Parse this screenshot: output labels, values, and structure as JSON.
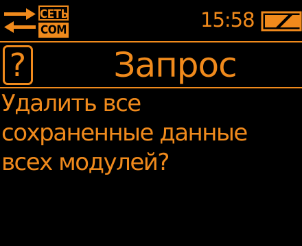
{
  "status_bar": {
    "link_top_label": "СЕТЬ",
    "link_bottom_label": "COM",
    "time": "15:58",
    "battery_icon": "battery-icon",
    "arrows_icon": "transfer-arrows-icon"
  },
  "dialog": {
    "icon": "question-icon",
    "icon_glyph": "?",
    "title": "Запрос",
    "message_lines": [
      "Удалить все",
      "сохраненные данные",
      "всех модулей?"
    ]
  },
  "colors": {
    "foreground": "#f08a1c",
    "background": "#000000"
  }
}
